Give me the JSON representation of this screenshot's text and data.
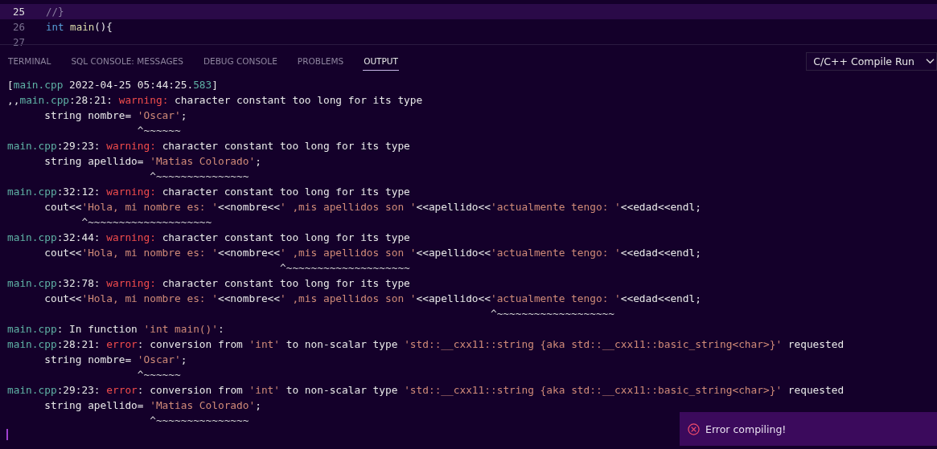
{
  "editor": {
    "lines": [
      {
        "number": "25",
        "current": true,
        "segments": [
          {
            "kind": "comment",
            "text": "//}"
          }
        ]
      },
      {
        "number": "26",
        "current": false,
        "segments": [
          {
            "kind": "keyword",
            "text": "int"
          },
          {
            "kind": "function",
            "text": " main"
          },
          {
            "kind": "plain",
            "text": "(){"
          }
        ]
      },
      {
        "number": "27",
        "current": false
      }
    ]
  },
  "panel": {
    "tabs": [
      {
        "label": "TERMINAL",
        "selected": false
      },
      {
        "label": "SQL CONSOLE: MESSAGES",
        "selected": false
      },
      {
        "label": "DEBUG CONSOLE",
        "selected": false
      },
      {
        "label": "PROBLEMS",
        "selected": false
      },
      {
        "label": "OUTPUT",
        "selected": true
      }
    ],
    "channel_dropdown": {
      "value": "C/C++ Compile Run"
    },
    "output_lines": [
      [
        {
          "kind": "plain",
          "text": "["
        },
        {
          "kind": "file",
          "text": "main.cpp"
        },
        {
          "kind": "plain",
          "text": " 2022-04-25 05:44:25."
        },
        {
          "kind": "number",
          "text": "583"
        },
        {
          "kind": "plain",
          "text": "]"
        }
      ],
      [
        {
          "kind": "plain",
          "text": ",,"
        },
        {
          "kind": "file",
          "text": "main.cpp"
        },
        {
          "kind": "plain",
          "text": ":28:21: "
        },
        {
          "kind": "warning",
          "text": "warning:"
        },
        {
          "kind": "plain",
          "text": " character constant too long for its type"
        }
      ],
      [
        {
          "kind": "plain",
          "text": "      string nombre= "
        },
        {
          "kind": "string",
          "text": "'Oscar'"
        },
        {
          "kind": "plain",
          "text": ";"
        }
      ],
      [
        {
          "kind": "caret",
          "text": "                     ^~~~~~~"
        }
      ],
      [
        {
          "kind": "file",
          "text": "main.cpp"
        },
        {
          "kind": "plain",
          "text": ":29:23: "
        },
        {
          "kind": "warning",
          "text": "warning:"
        },
        {
          "kind": "plain",
          "text": " character constant too long for its type"
        }
      ],
      [
        {
          "kind": "plain",
          "text": "      string apellido= "
        },
        {
          "kind": "string",
          "text": "'Matias Colorado'"
        },
        {
          "kind": "plain",
          "text": ";"
        }
      ],
      [
        {
          "kind": "caret",
          "text": "                       ^~~~~~~~~~~~~~~~"
        }
      ],
      [
        {
          "kind": "file",
          "text": "main.cpp"
        },
        {
          "kind": "plain",
          "text": ":32:12: "
        },
        {
          "kind": "warning",
          "text": "warning:"
        },
        {
          "kind": "plain",
          "text": " character constant too long for its type"
        }
      ],
      [
        {
          "kind": "plain",
          "text": "      cout<<"
        },
        {
          "kind": "string",
          "text": "'Hola, mi nombre es: '"
        },
        {
          "kind": "plain",
          "text": "<<nombre<<"
        },
        {
          "kind": "string",
          "text": "' ,mis apellidos son '"
        },
        {
          "kind": "plain",
          "text": "<<apellido<<"
        },
        {
          "kind": "string",
          "text": "'actualmente tengo: '"
        },
        {
          "kind": "plain",
          "text": "<<edad<<endl;"
        }
      ],
      [
        {
          "kind": "caret",
          "text": "            ^~~~~~~~~~~~~~~~~~~~~"
        }
      ],
      [
        {
          "kind": "file",
          "text": "main.cpp"
        },
        {
          "kind": "plain",
          "text": ":32:44: "
        },
        {
          "kind": "warning",
          "text": "warning:"
        },
        {
          "kind": "plain",
          "text": " character constant too long for its type"
        }
      ],
      [
        {
          "kind": "plain",
          "text": "      cout<<"
        },
        {
          "kind": "string",
          "text": "'Hola, mi nombre es: '"
        },
        {
          "kind": "plain",
          "text": "<<nombre<<"
        },
        {
          "kind": "string",
          "text": "' ,mis apellidos son '"
        },
        {
          "kind": "plain",
          "text": "<<apellido<<"
        },
        {
          "kind": "string",
          "text": "'actualmente tengo: '"
        },
        {
          "kind": "plain",
          "text": "<<edad<<endl;"
        }
      ],
      [
        {
          "kind": "caret",
          "text": "                                            ^~~~~~~~~~~~~~~~~~~~~"
        }
      ],
      [
        {
          "kind": "file",
          "text": "main.cpp"
        },
        {
          "kind": "plain",
          "text": ":32:78: "
        },
        {
          "kind": "warning",
          "text": "warning:"
        },
        {
          "kind": "plain",
          "text": " character constant too long for its type"
        }
      ],
      [
        {
          "kind": "plain",
          "text": "      cout<<"
        },
        {
          "kind": "string",
          "text": "'Hola, mi nombre es: '"
        },
        {
          "kind": "plain",
          "text": "<<nombre<<"
        },
        {
          "kind": "string",
          "text": "' ,mis apellidos son '"
        },
        {
          "kind": "plain",
          "text": "<<apellido<<"
        },
        {
          "kind": "string",
          "text": "'actualmente tengo: '"
        },
        {
          "kind": "plain",
          "text": "<<edad<<endl;"
        }
      ],
      [
        {
          "kind": "caret",
          "text": "                                                                              ^~~~~~~~~~~~~~~~~~~~"
        }
      ],
      [
        {
          "kind": "file",
          "text": "main.cpp"
        },
        {
          "kind": "plain",
          "text": ": In function "
        },
        {
          "kind": "string",
          "text": "'int main()'"
        },
        {
          "kind": "plain",
          "text": ":"
        }
      ],
      [
        {
          "kind": "file",
          "text": "main.cpp"
        },
        {
          "kind": "plain",
          "text": ":28:21: "
        },
        {
          "kind": "error",
          "text": "error"
        },
        {
          "kind": "plain",
          "text": ": conversion from "
        },
        {
          "kind": "string",
          "text": "'int'"
        },
        {
          "kind": "plain",
          "text": " to non-scalar type "
        },
        {
          "kind": "string",
          "text": "'std::__cxx11::string {aka std::__cxx11::basic_string<char>}'"
        },
        {
          "kind": "plain",
          "text": " requested"
        }
      ],
      [
        {
          "kind": "plain",
          "text": "      string nombre= "
        },
        {
          "kind": "string",
          "text": "'Oscar'"
        },
        {
          "kind": "plain",
          "text": ";"
        }
      ],
      [
        {
          "kind": "caret",
          "text": "                     ^~~~~~~"
        }
      ],
      [
        {
          "kind": "file",
          "text": "main.cpp"
        },
        {
          "kind": "plain",
          "text": ":29:23: "
        },
        {
          "kind": "error",
          "text": "error"
        },
        {
          "kind": "plain",
          "text": ": conversion from "
        },
        {
          "kind": "string",
          "text": "'int'"
        },
        {
          "kind": "plain",
          "text": " to non-scalar type "
        },
        {
          "kind": "string",
          "text": "'std::__cxx11::string {aka std::__cxx11::basic_string<char>}'"
        },
        {
          "kind": "plain",
          "text": " requested"
        }
      ],
      [
        {
          "kind": "plain",
          "text": "      string apellido= "
        },
        {
          "kind": "string",
          "text": "'Matias Colorado'"
        },
        {
          "kind": "plain",
          "text": ";"
        }
      ],
      [
        {
          "kind": "caret",
          "text": "                       ^~~~~~~~~~~~~~~~"
        }
      ]
    ]
  },
  "notification": {
    "message": "Error compiling!"
  }
}
